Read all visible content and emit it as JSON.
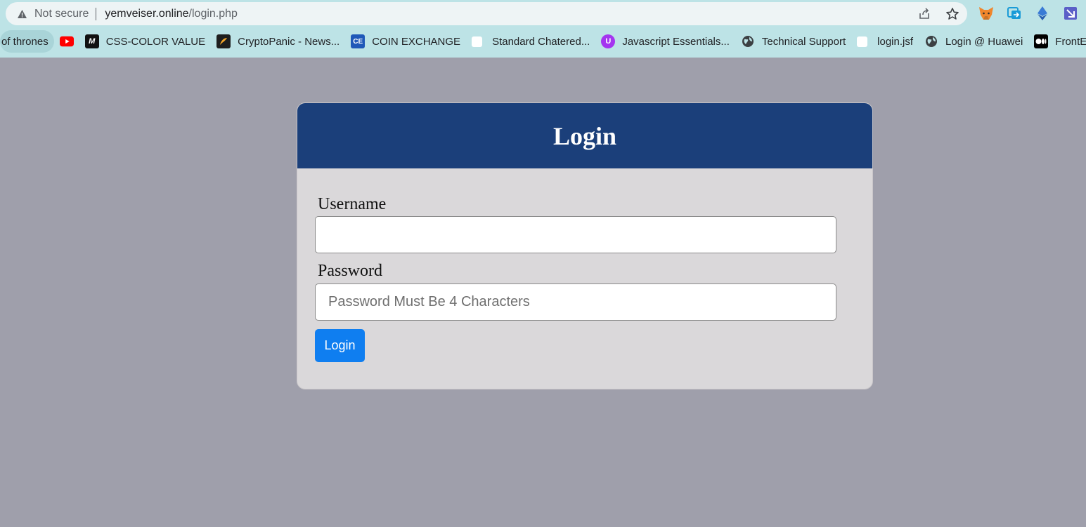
{
  "browser": {
    "security_label": "Not secure",
    "url_host": "yemveiser.online",
    "url_path": "/login.php"
  },
  "bookmarks": [
    {
      "label": "of thrones",
      "icon": "none"
    },
    {
      "label": "",
      "icon": "youtube-icon"
    },
    {
      "label": "CSS-COLOR VALUE",
      "icon": "m-logo-icon"
    },
    {
      "label": "CryptoPanic - News...",
      "icon": "cryptopanic-icon"
    },
    {
      "label": "COIN EXCHANGE",
      "icon": "ce-icon"
    },
    {
      "label": "Standard Chatered...",
      "icon": "blank-page-icon"
    },
    {
      "label": "Javascript Essentials...",
      "icon": "udemy-icon"
    },
    {
      "label": "Technical Support",
      "icon": "globe-icon"
    },
    {
      "label": "login.jsf",
      "icon": "blank-page-icon"
    },
    {
      "label": "Login @ Huawei",
      "icon": "globe-icon"
    },
    {
      "label": "FrontEn",
      "icon": "medium-icon"
    }
  ],
  "form": {
    "title": "Login",
    "username_label": "Username",
    "username_value": "",
    "password_label": "Password",
    "password_placeholder": "Password Must Be 4 Characters",
    "submit_label": "Login"
  },
  "colors": {
    "page_bg": "#9f9fab",
    "header_bg": "#1b3f7a",
    "card_bg": "#dad8da",
    "button_bg": "#0f7ef0"
  }
}
